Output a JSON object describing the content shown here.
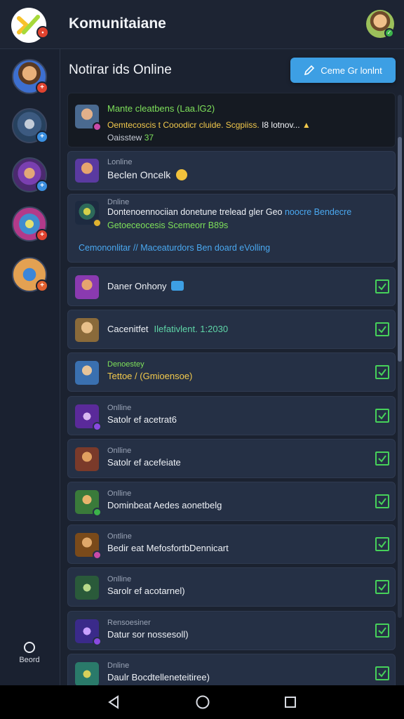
{
  "header": {
    "app_title": "Komunitaiane"
  },
  "sidebar": {
    "items": [
      {
        "name": "server-1"
      },
      {
        "name": "server-2"
      },
      {
        "name": "server-3"
      },
      {
        "name": "server-4"
      },
      {
        "name": "server-5"
      }
    ],
    "record_label": "Beord"
  },
  "main": {
    "title": "Notirar ids Online",
    "cta_label": "Ceme Gr lonlnt"
  },
  "list": {
    "top_card": {
      "title": "Mante cleatbens (Laa.lG2)",
      "line1": "Oemtecoscis t Cooodicr cluide. Scgpiiss. ",
      "line1_accent": "I8 lotnov...",
      "line2": "Oaisstew",
      "line2_accent": "37"
    },
    "row2": {
      "status": "Lonline",
      "name": "Beclen Oncelk"
    },
    "row3": {
      "status": "Dnline",
      "line1": "Dontenoennociian donetune trelead gler Geo ",
      "line1_accent": "noocre Bendecre",
      "line2": "Getoeceocesis Scemeorr B89s",
      "link": "Cemononlitar // Maceaturdors Ben doard eVolling"
    },
    "rows": [
      {
        "status": "",
        "name": "Daner Onhony",
        "extra": "",
        "checked": true
      },
      {
        "status": "",
        "name": "Cacenitfet",
        "extra": "Ilefativlent. 1:2030",
        "checked": true
      },
      {
        "status": "Denoestey",
        "name": "Tettoe / (Gmioensoe)",
        "extra": "",
        "checked": true
      },
      {
        "status": "Onlline",
        "name": "Satolr ef acetrat6",
        "extra": "",
        "checked": true
      },
      {
        "status": "Onlline",
        "name": "Satolr ef acefeiate",
        "extra": "",
        "checked": true
      },
      {
        "status": "Onlline",
        "name": "Dominbeat Aedes aonetbelg",
        "extra": "",
        "checked": true
      },
      {
        "status": "Ontline",
        "name": "Bedir eat MefosfortbDennicart",
        "extra": "",
        "checked": true
      },
      {
        "status": "Onlline",
        "name": "Sarolr ef acotarnel)",
        "extra": "",
        "checked": true
      },
      {
        "status": "Rensoesiner",
        "name": "Datur sor nossesoll)",
        "extra": "",
        "checked": true
      },
      {
        "status": "Dnline",
        "name": "Daulr Bocdtelleneteitiree)",
        "extra": "",
        "checked": true
      }
    ]
  },
  "colors": {
    "background": "#1b2230",
    "card": "#253045",
    "accent_blue": "#3d9fe4",
    "check_green": "#46d15a",
    "text_green": "#7ee05a",
    "text_yellow": "#f2c94c",
    "link_blue": "#4aa8f0"
  },
  "icons": {
    "cta": "pencil-icon",
    "nav": [
      "back-triangle-icon",
      "home-circle-icon",
      "recents-square-icon"
    ]
  }
}
